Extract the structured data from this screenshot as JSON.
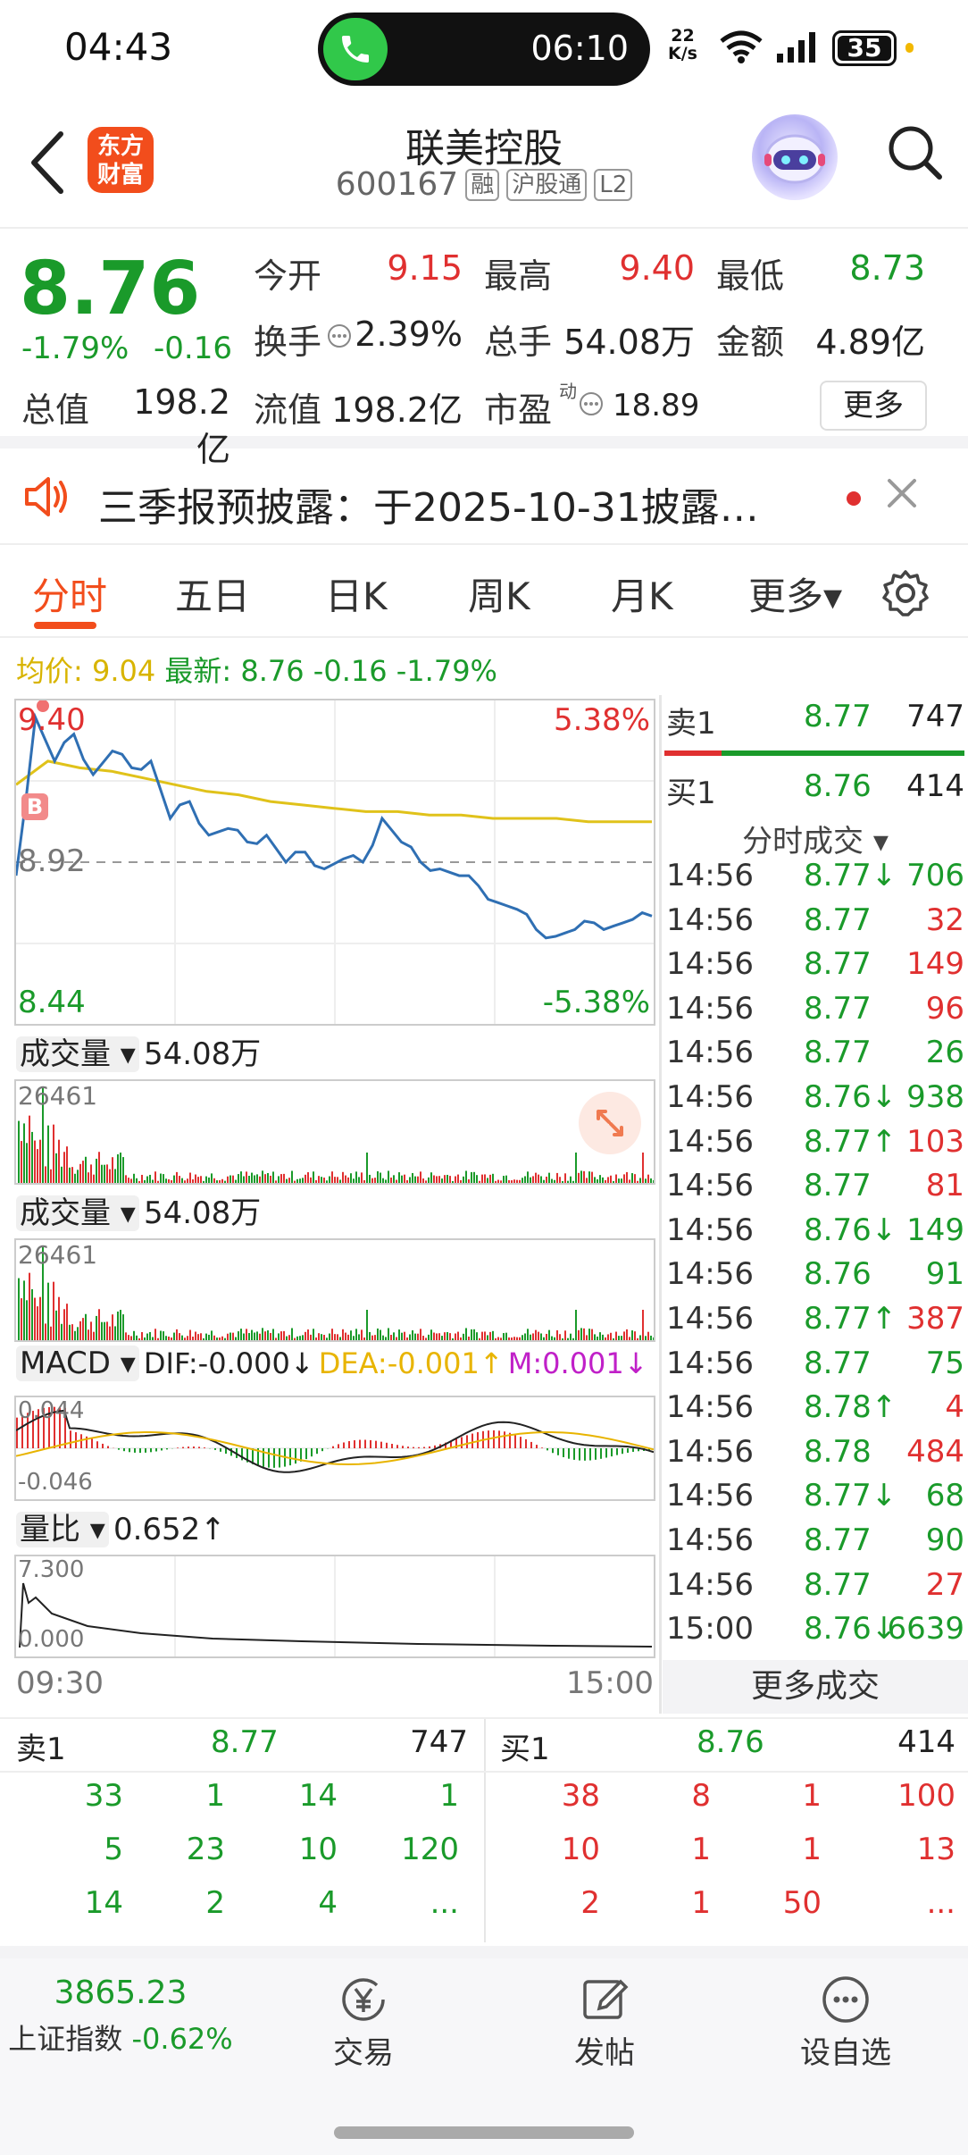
{
  "status_bar": {
    "time": "04:43",
    "call_timer": "06:10",
    "net_speed_value": "22",
    "net_speed_unit": "K/s",
    "battery": "35"
  },
  "header": {
    "logo_line1": "东方",
    "logo_line2": "财富",
    "stock_name": "联美控股",
    "stock_code": "600167",
    "tags": [
      "融",
      "沪股通",
      "L2"
    ]
  },
  "quote": {
    "last_price": "8.76",
    "pct_change": "-1.79%",
    "abs_change": "-0.16",
    "open_label": "今开",
    "open_value": "9.15",
    "high_label": "最高",
    "high_value": "9.40",
    "low_label": "最低",
    "low_value": "8.73",
    "turnover_label": "换手",
    "turnover_value": "2.39%",
    "volume_label": "总手",
    "volume_value": "54.08万",
    "amount_label": "金额",
    "amount_value": "4.89亿",
    "mcap_label": "总值",
    "mcap_value": "198.2亿",
    "float_label": "流值",
    "float_value": "198.2亿",
    "pe_label": "市盈",
    "pe_sup": "动",
    "pe_value": "18.89",
    "more_button": "更多"
  },
  "notice": {
    "text": "三季报预披露：于2025-10-31披露…"
  },
  "tabs": [
    "分时",
    "五日",
    "日K",
    "周K",
    "月K",
    "更多▾"
  ],
  "chart": {
    "legend_avg_label": "均价:",
    "legend_avg_value": "9.04",
    "legend_last_label": "最新:",
    "legend_last_value": "8.76",
    "legend_change": "-0.16",
    "legend_pct": "-1.79%",
    "price_high": "9.40",
    "price_mid": "8.92",
    "price_low": "8.44",
    "pct_high": "5.38%",
    "pct_low": "-5.38%",
    "buy_marker": "B",
    "vol_label": "成交量",
    "vol_value": "54.08万",
    "vol_max": "26461",
    "vol2_label": "成交量",
    "vol2_value": "54.08万",
    "vol2_max": "26461",
    "macd_label": "MACD",
    "macd_dif": "DIF:-0.000↓",
    "macd_dea": "DEA:-0.001↑",
    "macd_m": "M:0.001↓",
    "macd_max": "0.044",
    "macd_min": "-0.046",
    "ratio_label": "量比",
    "ratio_value": "0.652↑",
    "ratio_max": "7.300",
    "ratio_min": "0.000",
    "time_start": "09:30",
    "time_end": "15:00"
  },
  "chart_data": {
    "type": "line",
    "title": "",
    "x_range": [
      "09:30",
      "15:00"
    ],
    "ylim": [
      8.44,
      9.4
    ],
    "reference_price": 8.92,
    "series": [
      {
        "values": [
          8.88,
          9.35,
          9.22,
          9.3,
          9.18,
          9.25,
          9.2,
          9.22,
          9.05,
          9.1,
          9.0,
          9.02,
          8.98,
          9.0,
          8.92,
          8.95,
          8.9,
          8.93,
          8.92,
          9.05,
          8.98,
          8.92,
          8.9,
          8.88,
          8.85,
          8.8,
          8.78,
          8.72,
          8.7,
          8.72,
          8.74,
          8.73,
          8.75,
          8.76
        ]
      },
      {
        "values": [
          9.15,
          9.22,
          9.2,
          9.19,
          9.17,
          9.15,
          9.13,
          9.12,
          9.1,
          9.09,
          9.08,
          9.07,
          9.07,
          9.06,
          9.06,
          9.05,
          9.05,
          9.05,
          9.04,
          9.04,
          9.04
        ]
      }
    ]
  },
  "trades": {
    "sell1_label": "卖1",
    "sell1_price": "8.77",
    "sell1_vol": "747",
    "buy1_label": "买1",
    "buy1_price": "8.76",
    "buy1_vol": "414",
    "header": "分时成交 ▾",
    "rows": [
      {
        "t": "14:56",
        "p": "8.77↓",
        "v": "706",
        "pc": "green",
        "vc": "green"
      },
      {
        "t": "14:56",
        "p": "8.77",
        "v": "32",
        "pc": "green",
        "vc": "red"
      },
      {
        "t": "14:56",
        "p": "8.77",
        "v": "149",
        "pc": "green",
        "vc": "red"
      },
      {
        "t": "14:56",
        "p": "8.77",
        "v": "96",
        "pc": "green",
        "vc": "red"
      },
      {
        "t": "14:56",
        "p": "8.77",
        "v": "26",
        "pc": "green",
        "vc": "green"
      },
      {
        "t": "14:56",
        "p": "8.76↓",
        "v": "938",
        "pc": "green",
        "vc": "green"
      },
      {
        "t": "14:56",
        "p": "8.77↑",
        "v": "103",
        "pc": "green",
        "vc": "red"
      },
      {
        "t": "14:56",
        "p": "8.77",
        "v": "81",
        "pc": "green",
        "vc": "red"
      },
      {
        "t": "14:56",
        "p": "8.76↓",
        "v": "149",
        "pc": "green",
        "vc": "green"
      },
      {
        "t": "14:56",
        "p": "8.76",
        "v": "91",
        "pc": "green",
        "vc": "green"
      },
      {
        "t": "14:56",
        "p": "8.77↑",
        "v": "387",
        "pc": "green",
        "vc": "red"
      },
      {
        "t": "14:56",
        "p": "8.77",
        "v": "75",
        "pc": "green",
        "vc": "green"
      },
      {
        "t": "14:56",
        "p": "8.78↑",
        "v": "4",
        "pc": "green",
        "vc": "red"
      },
      {
        "t": "14:56",
        "p": "8.78",
        "v": "484",
        "pc": "green",
        "vc": "red"
      },
      {
        "t": "14:56",
        "p": "8.77↓",
        "v": "68",
        "pc": "green",
        "vc": "green"
      },
      {
        "t": "14:56",
        "p": "8.77",
        "v": "90",
        "pc": "green",
        "vc": "green"
      },
      {
        "t": "14:56",
        "p": "8.77",
        "v": "27",
        "pc": "green",
        "vc": "red"
      },
      {
        "t": "15:00",
        "p": "8.76↓",
        "v": "6639",
        "pc": "green",
        "vc": "green"
      }
    ],
    "more_trades": "更多成交"
  },
  "orderbook": {
    "sell_label": "卖1",
    "sell_price": "8.77",
    "sell_vol": "747",
    "buy_label": "买1",
    "buy_price": "8.76",
    "buy_vol": "414",
    "sell_grid": [
      [
        "33",
        "1",
        "14",
        "1"
      ],
      [
        "5",
        "23",
        "10",
        "120"
      ],
      [
        "14",
        "2",
        "4",
        "..."
      ]
    ],
    "buy_grid": [
      [
        "38",
        "8",
        "1",
        "100"
      ],
      [
        "10",
        "1",
        "1",
        "13"
      ],
      [
        "2",
        "1",
        "50",
        "..."
      ]
    ]
  },
  "bottom_nav": {
    "index_value": "3865.23",
    "index_name": "上证指数",
    "index_change": "-0.62%",
    "trade_label": "交易",
    "post_label": "发帖",
    "watch_label": "设自选"
  },
  "colors": {
    "up": "#e03030",
    "down": "#1a9a2a",
    "price_line": "#2f6fb3",
    "avg_line": "#e0c21a",
    "accent": "#f24d1c"
  }
}
